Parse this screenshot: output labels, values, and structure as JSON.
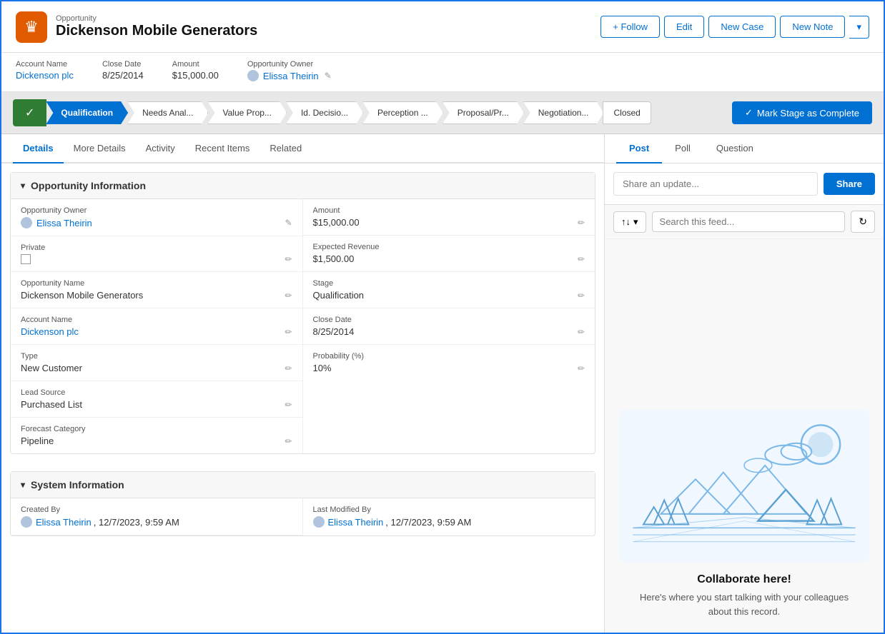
{
  "header": {
    "record_type": "Opportunity",
    "title": "Dickenson Mobile Generators",
    "app_icon": "♛",
    "actions": {
      "follow_label": "+ Follow",
      "edit_label": "Edit",
      "new_case_label": "New Case",
      "new_note_label": "New Note"
    }
  },
  "meta": {
    "account_name_label": "Account Name",
    "account_name_value": "Dickenson plc",
    "close_date_label": "Close Date",
    "close_date_value": "8/25/2014",
    "amount_label": "Amount",
    "amount_value": "$15,000.00",
    "owner_label": "Opportunity Owner",
    "owner_value": "Elissa Theirin"
  },
  "stages": {
    "completed_icon": "✓",
    "steps": [
      {
        "label": "Qualification",
        "state": "active"
      },
      {
        "label": "Needs Anal...",
        "state": "normal"
      },
      {
        "label": "Value Prop...",
        "state": "normal"
      },
      {
        "label": "Id. Decisio...",
        "state": "normal"
      },
      {
        "label": "Perception ...",
        "state": "normal"
      },
      {
        "label": "Proposal/Pr...",
        "state": "normal"
      },
      {
        "label": "Negotiation...",
        "state": "normal"
      },
      {
        "label": "Closed",
        "state": "last"
      }
    ],
    "complete_btn_label": "Mark Stage as Complete",
    "complete_btn_icon": "✓"
  },
  "tabs": {
    "left": [
      {
        "label": "Details",
        "active": true
      },
      {
        "label": "More Details",
        "active": false
      },
      {
        "label": "Activity",
        "active": false
      },
      {
        "label": "Recent Items",
        "active": false
      },
      {
        "label": "Related",
        "active": false
      }
    ]
  },
  "opportunity_info": {
    "section_label": "Opportunity Information",
    "fields_left": [
      {
        "label": "Opportunity Owner",
        "value": "Elissa Theirin",
        "is_link": true,
        "editable": true
      },
      {
        "label": "Private",
        "value": "",
        "is_checkbox": true,
        "editable": true
      },
      {
        "label": "Opportunity Name",
        "value": "Dickenson Mobile Generators",
        "is_link": false,
        "editable": true
      },
      {
        "label": "Account Name",
        "value": "Dickenson plc",
        "is_link": true,
        "editable": true
      },
      {
        "label": "Type",
        "value": "New Customer",
        "is_link": false,
        "editable": true
      },
      {
        "label": "Lead Source",
        "value": "Purchased List",
        "is_link": false,
        "editable": true
      },
      {
        "label": "Forecast Category",
        "value": "Pipeline",
        "is_link": false,
        "editable": true
      }
    ],
    "fields_right": [
      {
        "label": "Amount",
        "value": "$15,000.00",
        "is_link": false,
        "editable": true
      },
      {
        "label": "Expected Revenue",
        "value": "$1,500.00",
        "is_link": false,
        "editable": true
      },
      {
        "label": "Stage",
        "value": "Qualification",
        "is_link": false,
        "editable": true
      },
      {
        "label": "Close Date",
        "value": "8/25/2014",
        "is_link": false,
        "editable": true
      },
      {
        "label": "Probability (%)",
        "value": "10%",
        "is_link": false,
        "editable": true
      }
    ]
  },
  "system_info": {
    "section_label": "System Information",
    "created_by_label": "Created By",
    "created_by_value": "Elissa Theirin",
    "created_date": "12/7/2023, 9:59 AM",
    "modified_by_label": "Last Modified By",
    "modified_by_value": "Elissa Theirin",
    "modified_date": "12/7/2023, 9:59 AM"
  },
  "right_panel": {
    "tabs": [
      {
        "label": "Post",
        "active": true
      },
      {
        "label": "Poll",
        "active": false
      },
      {
        "label": "Question",
        "active": false
      }
    ],
    "share_placeholder": "Share an update...",
    "share_btn_label": "Share",
    "search_placeholder": "Search this feed...",
    "collab_title": "Collaborate here!",
    "collab_desc": "Here's where you start talking with your colleagues about this record."
  },
  "icons": {
    "pencil": "✏",
    "chevron_down": "▾",
    "sort": "↑↓",
    "refresh": "↻",
    "search": "🔍",
    "check": "✓"
  }
}
